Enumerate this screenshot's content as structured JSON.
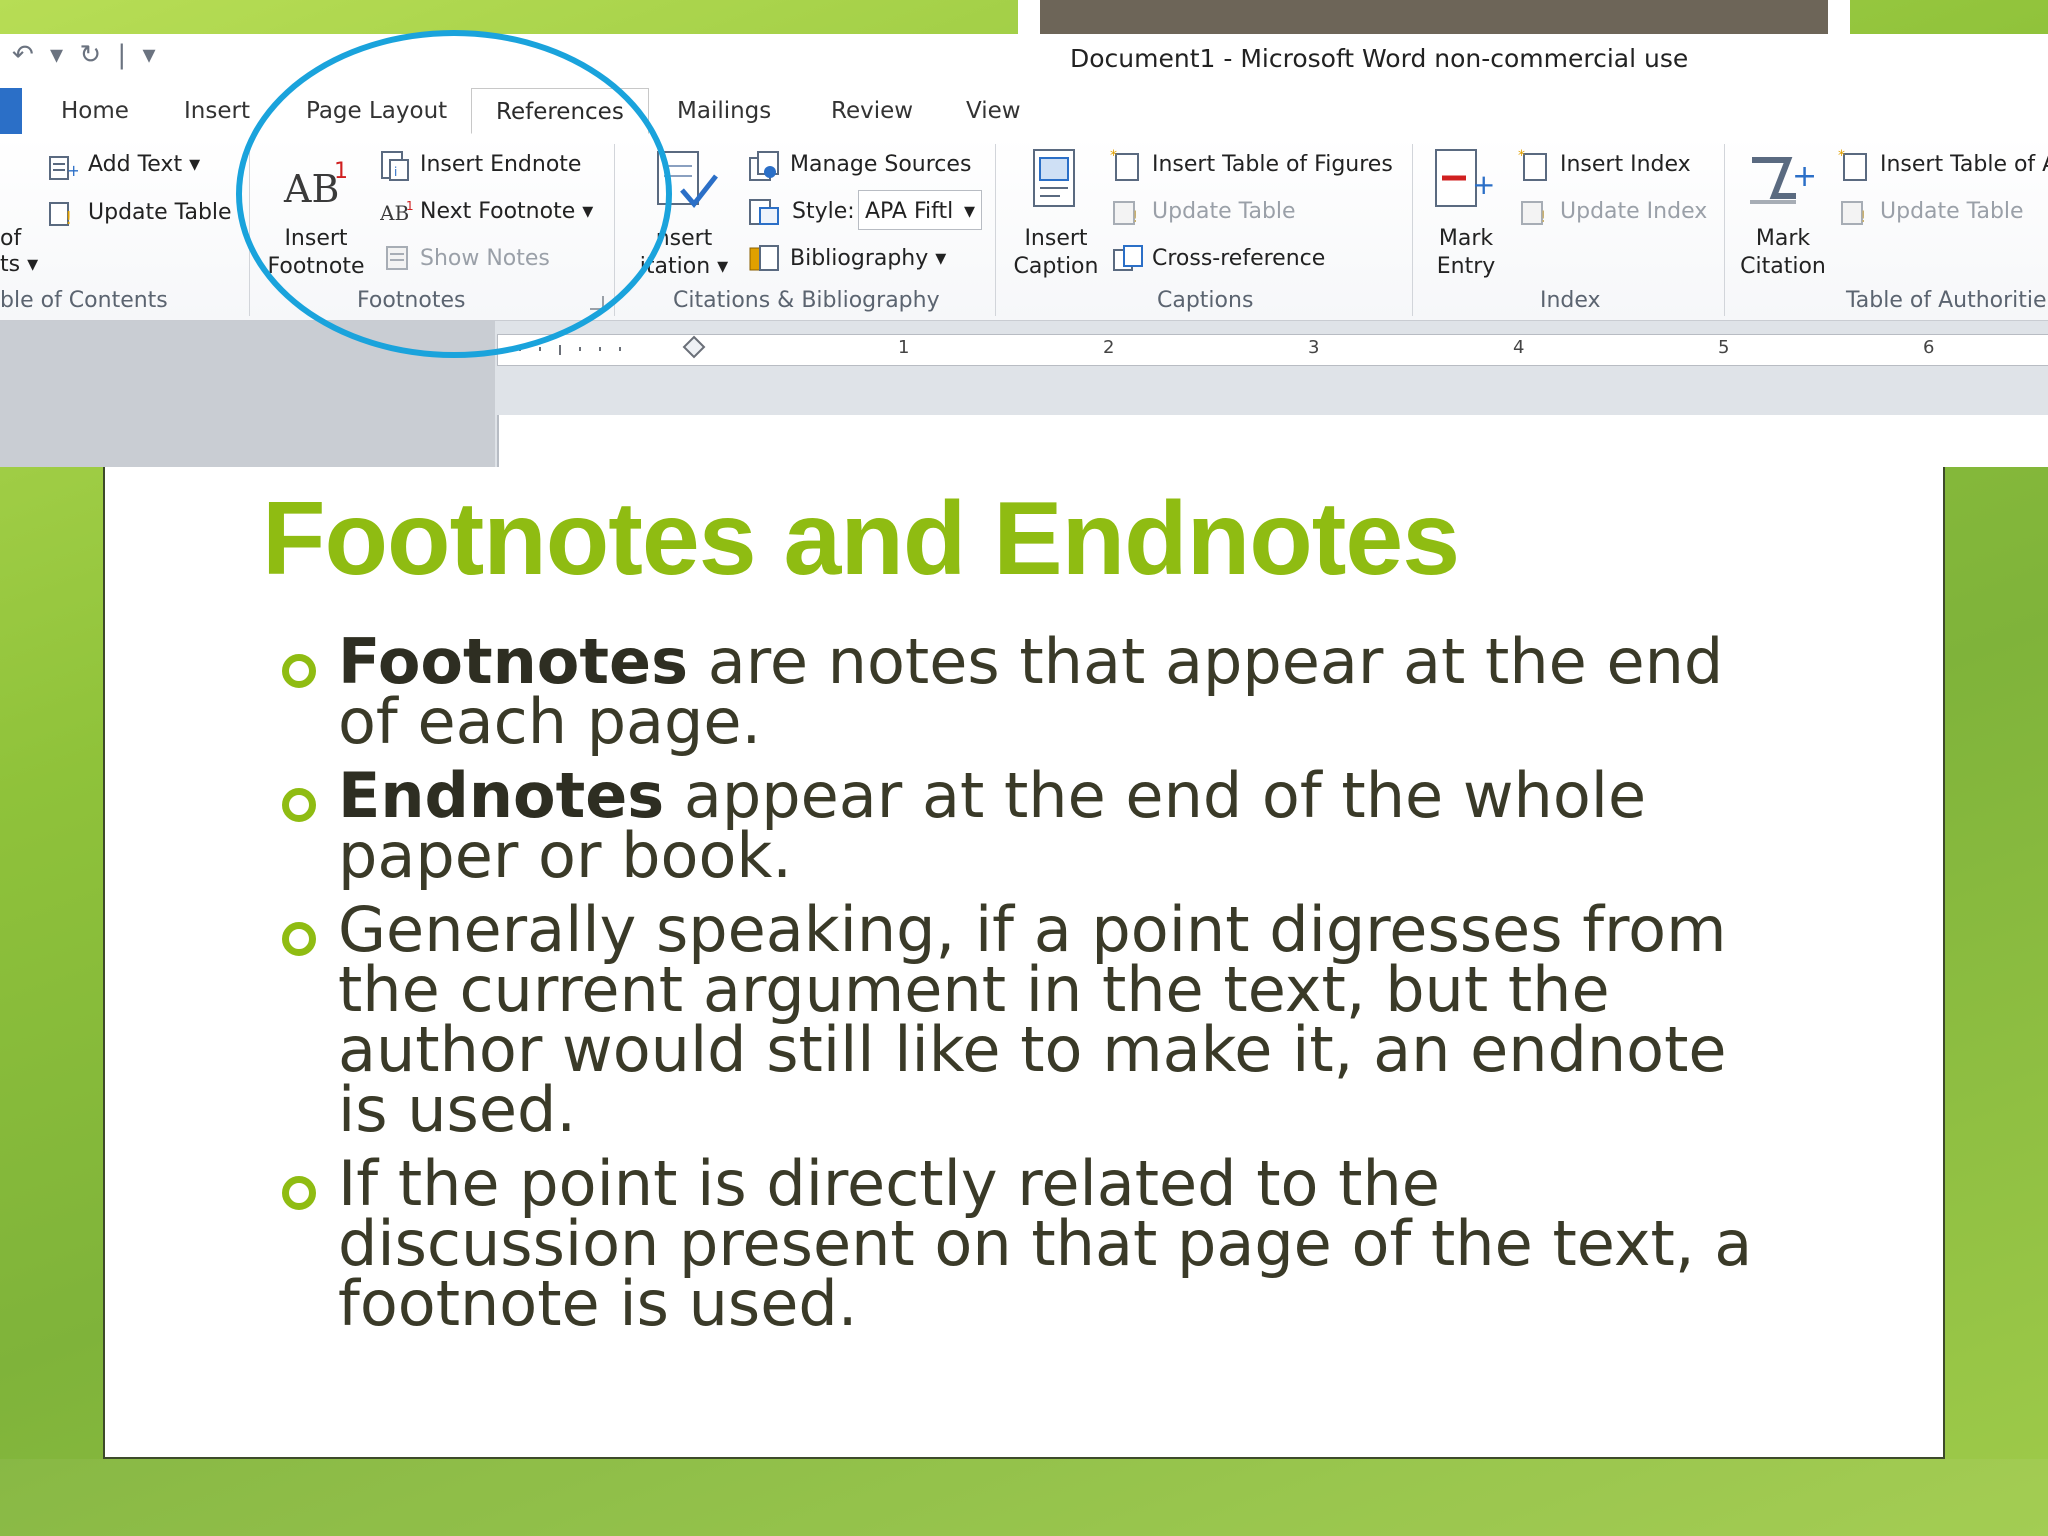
{
  "window": {
    "title": "Document1  -  Microsoft Word non-commercial use"
  },
  "tabs": [
    "Home",
    "Insert",
    "Page Layout",
    "References",
    "Mailings",
    "Review",
    "View"
  ],
  "active_tab": "References",
  "ribbon": {
    "toc": {
      "add_text": "Add Text",
      "update_table": "Update Table",
      "toc_partial_1": "of",
      "toc_partial_2": "ts",
      "group": "ble of Contents"
    },
    "footnotes": {
      "insert_footnote_1": "Insert",
      "insert_footnote_2": "Footnote",
      "insert_endnote": "Insert Endnote",
      "next_footnote": "Next Footnote",
      "show_notes": "Show Notes",
      "group": "Footnotes"
    },
    "citations": {
      "insert_citation_1": "nsert",
      "insert_citation_2": "itation",
      "manage_sources": "Manage Sources",
      "style_label": "Style:",
      "style_value": "APA Fiftl",
      "bibliography": "Bibliography",
      "group": "Citations & Bibliography"
    },
    "captions": {
      "insert_caption_1": "Insert",
      "insert_caption_2": "Caption",
      "insert_table_of_figures": "Insert Table of Figures",
      "update_table": "Update Table",
      "cross_reference": "Cross-reference",
      "group": "Captions"
    },
    "index": {
      "mark_entry_1": "Mark",
      "mark_entry_2": "Entry",
      "insert_index": "Insert Index",
      "update_index": "Update Index",
      "group": "Index"
    },
    "authorities": {
      "mark_citation_1": "Mark",
      "mark_citation_2": "Citation",
      "insert_table_of": "Insert Table of A",
      "update_table": "Update Table",
      "group": "Table of Authoritie"
    }
  },
  "ruler_numbers": [
    "1",
    "2",
    "3",
    "4",
    "5",
    "6"
  ],
  "slide": {
    "title": "Footnotes and Endnotes",
    "bullets": [
      {
        "bold": "Footnotes",
        "text": " are notes that appear at the end of each page."
      },
      {
        "bold": "Endnotes",
        "text": " appear at the end of the whole paper or book."
      },
      {
        "bold": "",
        "text": "Generally speaking, if a point digresses from the current argument in the text, but the author would still like to make it, an endnote is used."
      },
      {
        "bold": "",
        "text": "If the point is directly related to the discussion present on that page of the text, a footnote is used."
      }
    ]
  },
  "colors": {
    "accent_green": "#8fbc12",
    "annotation_circle": "#1aa3dc",
    "file_tab": "#2b6fc7"
  }
}
